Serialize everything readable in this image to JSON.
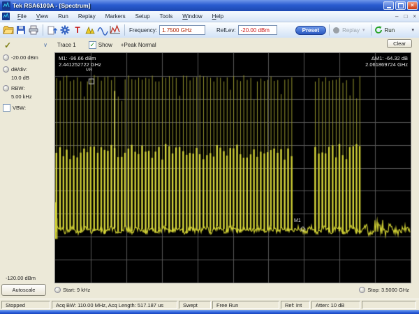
{
  "window": {
    "title": "Tek RSA6100A - [Spectrum]"
  },
  "menu": {
    "items": [
      {
        "u": "F",
        "rest": "ile"
      },
      {
        "u": "V",
        "rest": "iew"
      },
      {
        "u": "",
        "rest": "Run"
      },
      {
        "u": "",
        "rest": "Replay"
      },
      {
        "u": "",
        "rest": "Markers"
      },
      {
        "u": "",
        "rest": "Setup"
      },
      {
        "u": "",
        "rest": "Tools"
      },
      {
        "u": "W",
        "rest": "indow"
      },
      {
        "u": "H",
        "rest": "elp"
      }
    ]
  },
  "toolbar": {
    "frequency_label": "Frequency:",
    "frequency_value": "1.7500 GHz",
    "reflev_label": "RefLev:",
    "reflev_value": "-20.00 dBm",
    "preset_label": "Preset",
    "replay_label": "Replay",
    "run_label": "Run"
  },
  "trace_bar": {
    "trace_label": "Trace 1",
    "show_label": "Show",
    "check_glyph": "✓",
    "detector_label": "+Peak Normal",
    "clear_label": "Clear"
  },
  "sidebar": {
    "ref_level": "-20.00 dBm",
    "db_div_label": "dB/div:",
    "db_div_value": "10.0 dB",
    "rbw_label": "RBW:",
    "rbw_value": "5.00 kHz",
    "vbw_label": "VBW:",
    "bottom_level": "-120.00 dBm",
    "autoscale_label": "Autoscale"
  },
  "plot": {
    "m1_line1": "M1: -96.66 dBm",
    "m1_line2": "2.441252722 GHz",
    "d1_line1": "ΔM1: -64.32 dB",
    "d1_line2": "2.061869724 GHz"
  },
  "axis": {
    "start_label": "Start:",
    "start_value": "9 kHz",
    "stop_label": "Stop:",
    "stop_value": "3.5000 GHz"
  },
  "status": {
    "state": "Stopped",
    "acquisition": "Acq BW: 110.00 MHz, Acq Length: 517.187 us",
    "sweep": "Swept",
    "trigger": "Free Run",
    "reference": "Ref: Int",
    "attenuation": "Atten: 10 dB"
  },
  "colors": {
    "trace": "#d6d63c",
    "trace_dim": "#96962e",
    "noise": "#c9c932",
    "grid": "#575757",
    "plot_bg": "#000000",
    "preset_blue": "#2a58c0",
    "run_green": "#1fa01f",
    "frequency_text": "#b22200",
    "reflev_text": "#cc1111",
    "titlebar_blue": "#2a5cd0"
  },
  "chart_data": {
    "type": "line",
    "title": "Spectrum",
    "start": "9 kHz",
    "stop": "3.5000 GHz",
    "ylabel_top_dbm": -20,
    "ylabel_bottom_dbm": -120,
    "db_per_div": 10,
    "grid_divisions": 10,
    "noise_floor_dbm": -97,
    "comb_regions": [
      {
        "start_frac": 0.0,
        "end_frac": 0.665,
        "peak_top_dbm": -31,
        "dense_top_dbm": -63,
        "spike_spacing_px": 4.9
      },
      {
        "start_frac": 0.728,
        "end_frac": 0.865,
        "peak_top_dbm": -31.5,
        "dense_top_dbm": -63,
        "spike_spacing_px": 4.9
      }
    ],
    "left_edge_peak_dbm": -85,
    "tall_spike": {
      "frac": 0.166,
      "top_dbm": -36.5
    },
    "markers": [
      {
        "name": "M1",
        "frequency": "2.441252722 GHz",
        "level_dbm": -96.66,
        "x_frac": 0.697
      },
      {
        "name": "MR",
        "level_dbm": -32.34,
        "x_frac": 0.102
      }
    ],
    "delta": {
      "label": "ΔM1",
      "delta_db": -64.32,
      "delta_frequency": "2.061869724 GHz"
    }
  }
}
